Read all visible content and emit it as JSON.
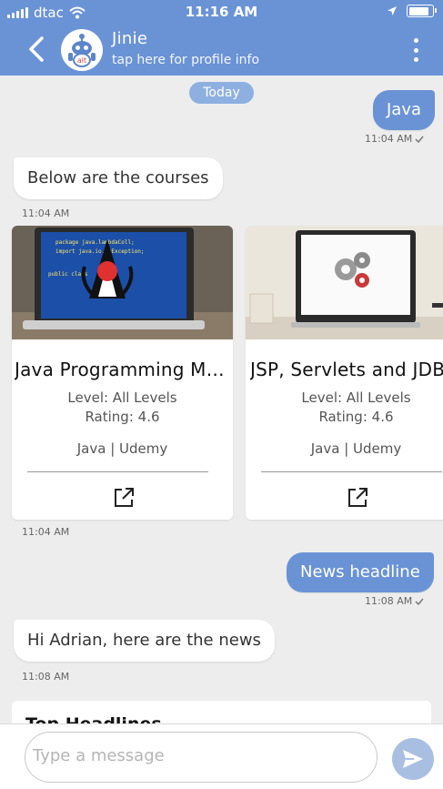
{
  "status_bar": {
    "carrier": "dtac",
    "time": "11:16 AM"
  },
  "header": {
    "name": "Jinie",
    "subtitle": "tap here for profile info",
    "avatar_label": "alt"
  },
  "chat": {
    "date_label": "Today",
    "messages": [
      {
        "direction": "out",
        "text": "Java",
        "time": "11:04 AM"
      },
      {
        "direction": "in",
        "text": "Below are the courses",
        "time": "11:04 AM"
      },
      {
        "direction": "in",
        "type": "cards",
        "time": "11:04 AM"
      },
      {
        "direction": "out",
        "text": "News headline",
        "time": "11:08 AM"
      },
      {
        "direction": "in",
        "text": "Hi Adrian, here are the news",
        "time": "11:08 AM"
      }
    ],
    "courses": [
      {
        "title": "Java Programming Ma...",
        "level": "Level: All Levels",
        "rating": "Rating: 4.6",
        "tags": "Java | Udemy"
      },
      {
        "title": "JSP, Servlets and JDBC",
        "level": "Level: All Levels",
        "rating": "Rating: 4.6",
        "tags": "Java | Udemy"
      }
    ],
    "news_card_title": "Top Headlines"
  },
  "composer": {
    "placeholder": "Type a message",
    "value": ""
  },
  "colors": {
    "header_bg": "#6a93d6",
    "outgoing_bubble": "#6a93d6",
    "chat_bg": "#ededed",
    "send_button": "#a9bfe2"
  },
  "icons": [
    "back-arrow-icon",
    "menu-dots-icon",
    "open-link-icon",
    "send-icon",
    "wifi-icon",
    "location-icon",
    "battery-icon",
    "checkmark-icon"
  ]
}
